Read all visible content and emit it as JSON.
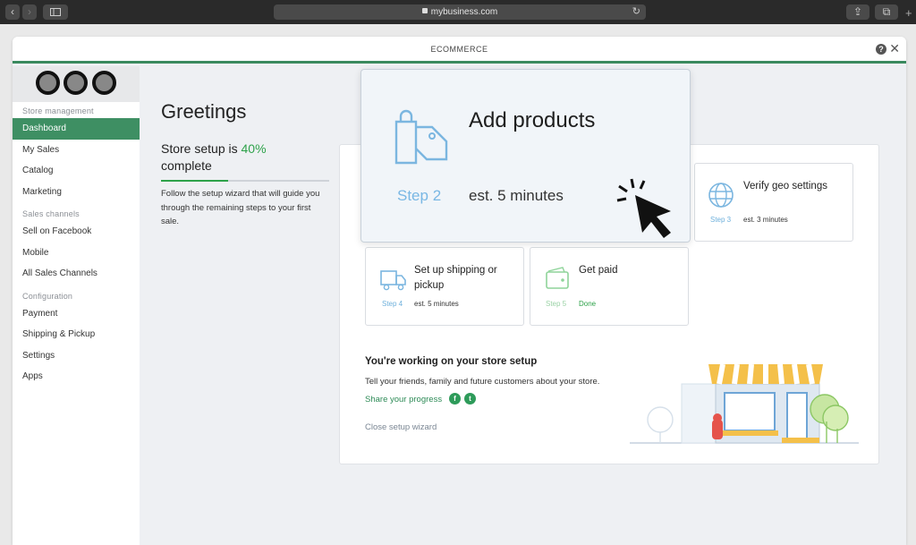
{
  "browser": {
    "url": "mybusiness.com"
  },
  "window": {
    "title": "ECOMMERCE",
    "help": "?",
    "close": "✕"
  },
  "sidebar": {
    "sections": [
      {
        "label": "Store management",
        "items": [
          "Dashboard",
          "My Sales",
          "Catalog",
          "Marketing"
        ]
      },
      {
        "label": "Sales channels",
        "items": [
          "Sell on Facebook",
          "Mobile",
          "All Sales Channels"
        ]
      },
      {
        "label": "Configuration",
        "items": [
          "Payment",
          "Shipping & Pickup",
          "Settings",
          "Apps"
        ]
      }
    ],
    "active_item": "Dashboard"
  },
  "main": {
    "greeting": "Greetings",
    "setup_prefix": "Store setup is",
    "setup_percent": "40%",
    "setup_suffix": "complete",
    "progress": 0.4,
    "follow_text": "Follow the setup wizard that will guide you through the remaining steps to your first sale.",
    "cards": {
      "add_products": {
        "title": "Add products",
        "step": "Step 2",
        "est": "est. 5 minutes"
      },
      "verify_geo": {
        "title": "Verify geo settings",
        "step": "Step 3",
        "est": "est. 3 minutes"
      },
      "shipping": {
        "title": "Set up shipping or pickup",
        "step": "Step 4",
        "est": "est. 5 minutes"
      },
      "get_paid": {
        "title": "Get paid",
        "step": "Step 5",
        "est": "Done"
      }
    },
    "working_title": "You're working on your store setup",
    "tell_text": "Tell your friends, family and future customers about your store.",
    "share_label": "Share your progress",
    "close_wizard": "Close setup wizard"
  },
  "colors": {
    "accent_green": "#3e8f63",
    "progress_green": "#2ea24a",
    "step_blue": "#6eb0dc"
  }
}
